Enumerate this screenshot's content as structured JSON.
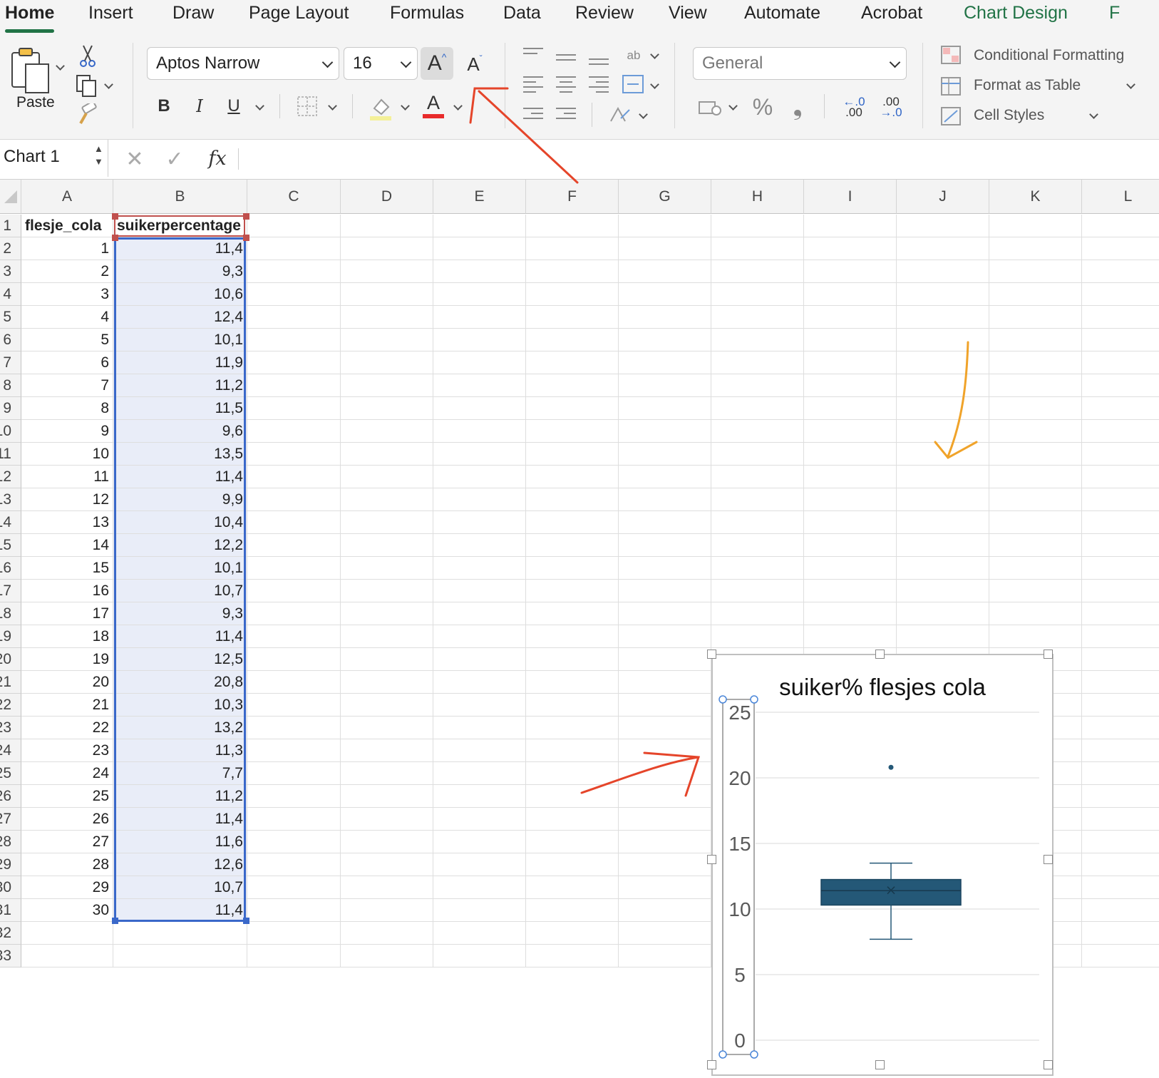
{
  "ribbon_tabs": [
    "Home",
    "Insert",
    "Draw",
    "Page Layout",
    "Formulas",
    "Data",
    "Review",
    "View",
    "Automate",
    "Acrobat",
    "Chart Design",
    "F"
  ],
  "clipboard": {
    "paste_label": "Paste"
  },
  "font": {
    "name": "Aptos Narrow",
    "size": "16",
    "grow_label": "A",
    "shrink_label": "A",
    "bold": "B",
    "italic": "I",
    "underline": "U",
    "color_letter": "A"
  },
  "number": {
    "format": "General",
    "percent": "%",
    "comma": "❟"
  },
  "styles": {
    "conditional": "Conditional Formatting",
    "format_table": "Format as Table",
    "cell_styles": "Cell Styles"
  },
  "formula_bar": {
    "name_box": "Chart 1",
    "fx": "fx",
    "content": ""
  },
  "columns": [
    "A",
    "B",
    "C",
    "D",
    "E",
    "F",
    "G",
    "H",
    "I",
    "J",
    "K",
    "L"
  ],
  "rows": [
    "1",
    "2",
    "3",
    "4",
    "5",
    "6",
    "7",
    "8",
    "9",
    "10",
    "11",
    "12",
    "13",
    "14",
    "15",
    "16",
    "17",
    "18",
    "19",
    "20",
    "21",
    "22",
    "23",
    "24",
    "25",
    "26",
    "27",
    "28",
    "29",
    "30",
    "31",
    "32",
    "33"
  ],
  "table": {
    "headers": [
      "flesje_cola",
      "suikerpercentage"
    ],
    "col_a": [
      "1",
      "2",
      "3",
      "4",
      "5",
      "6",
      "7",
      "8",
      "9",
      "10",
      "11",
      "12",
      "13",
      "14",
      "15",
      "16",
      "17",
      "18",
      "19",
      "20",
      "21",
      "22",
      "23",
      "24",
      "25",
      "26",
      "27",
      "28",
      "29",
      "30"
    ],
    "col_b": [
      "11,4",
      "9,3",
      "10,6",
      "12,4",
      "10,1",
      "11,9",
      "11,2",
      "11,5",
      "9,6",
      "13,5",
      "11,4",
      "9,9",
      "10,4",
      "12,2",
      "10,1",
      "10,7",
      "9,3",
      "11,4",
      "12,5",
      "20,8",
      "10,3",
      "13,2",
      "11,3",
      "7,7",
      "11,2",
      "11,4",
      "11,6",
      "12,6",
      "10,7",
      "11,4"
    ]
  },
  "chart_data": {
    "type": "box",
    "title": "suiker% flesjes cola",
    "ylim": [
      0,
      25
    ],
    "yticks": [
      "0",
      "5",
      "10",
      "15",
      "20",
      "25"
    ],
    "grid": true,
    "box": {
      "q1": 10.3,
      "median": 11.4,
      "q3": 12.25,
      "mean": 11.43,
      "whisker_low": 7.7,
      "whisker_high": 13.5,
      "outliers": [
        20.8
      ]
    },
    "box_color": "#245877"
  },
  "colors": {
    "accent": "#217346",
    "selection_border": "#3a68c9",
    "annotation_red": "#e5452a",
    "annotation_orange": "#f0a32a"
  }
}
